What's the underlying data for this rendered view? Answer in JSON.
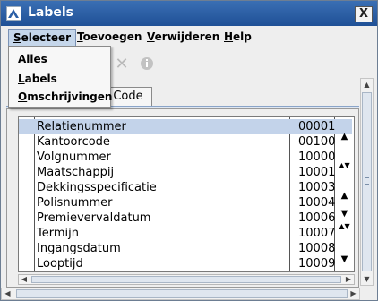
{
  "window": {
    "title": "Labels",
    "close_label": "X"
  },
  "menubar": {
    "items": [
      {
        "mnemonic": "S",
        "rest": "electeer"
      },
      {
        "mnemonic": "T",
        "rest": "oevoegen"
      },
      {
        "mnemonic": "V",
        "rest": "erwijderen"
      },
      {
        "mnemonic": "H",
        "rest": "elp"
      }
    ]
  },
  "dropdown": {
    "items": [
      {
        "mnemonic": "A",
        "rest": "lles"
      },
      {
        "mnemonic": "L",
        "rest": "abels"
      },
      {
        "mnemonic": "O",
        "rest": "mschrijvingen"
      }
    ]
  },
  "toolbar": {
    "icons": [
      "delete-icon",
      "info-icon"
    ]
  },
  "tabs": {
    "active": "Code"
  },
  "list": {
    "rows": [
      {
        "label": "Relatienummer",
        "code": "00001",
        "selected": true
      },
      {
        "label": "Kantoorcode",
        "code": "00100"
      },
      {
        "label": "Volgnummer",
        "code": "10000"
      },
      {
        "label": "Maatschappij",
        "code": "10001"
      },
      {
        "label": "Dekkingsspecificatie",
        "code": "10003"
      },
      {
        "label": "Polisnummer",
        "code": "10004"
      },
      {
        "label": "Premievervaldatum",
        "code": "10006"
      },
      {
        "label": "Termijn",
        "code": "10007"
      },
      {
        "label": "Ingangsdatum",
        "code": "10008"
      },
      {
        "label": "Looptijd",
        "code": "10009"
      }
    ],
    "move_buttons": [
      "▲",
      "▲▼",
      "▲",
      "▼",
      "▲▼",
      "▼"
    ]
  },
  "colors": {
    "titlebar": "#2b5fa6",
    "selection": "#c3d3ea"
  }
}
